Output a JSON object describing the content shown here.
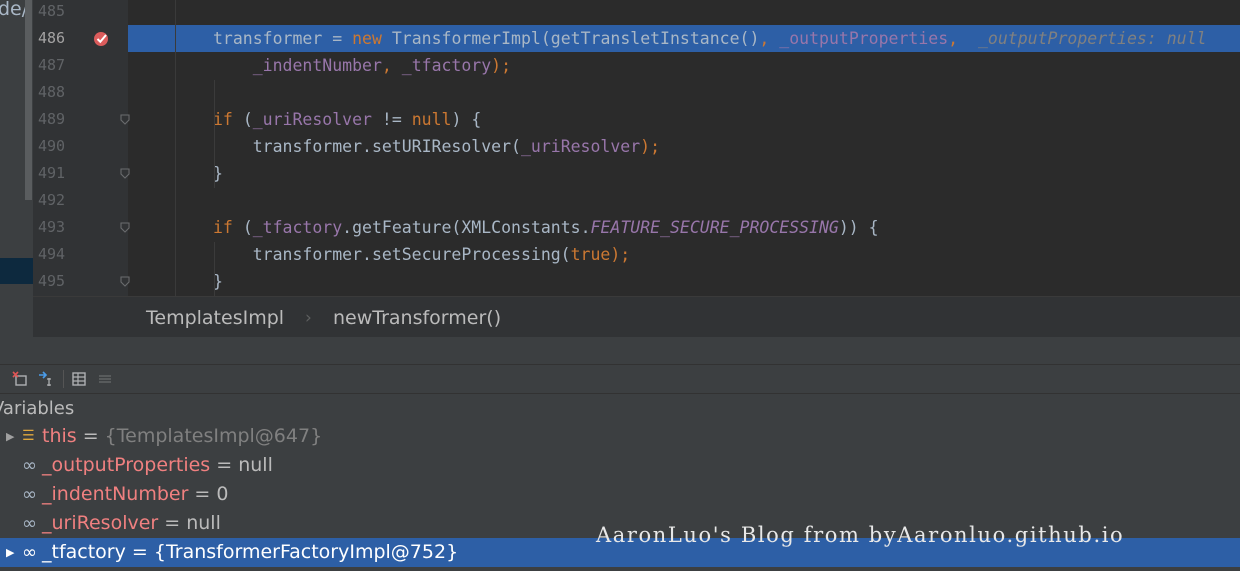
{
  "project_panel": {
    "text": "de/l"
  },
  "editor": {
    "lines": [
      {
        "num": "485",
        "parts": []
      },
      {
        "num": "486",
        "breakpoint": true,
        "highlighted": true,
        "parts": [
          {
            "t": "transformer ",
            "c": "plain"
          },
          {
            "t": "= ",
            "c": "plain"
          },
          {
            "t": "new ",
            "c": "kw"
          },
          {
            "t": "TransformerImpl(getTransletInstance()",
            "c": "plain"
          },
          {
            "t": ", ",
            "c": "kw"
          },
          {
            "t": "_outputProperties",
            "c": "fld"
          },
          {
            "t": ",  ",
            "c": "kw"
          },
          {
            "t": "_outputProperties: null",
            "c": "dbg"
          }
        ]
      },
      {
        "num": "487",
        "parts": [
          {
            "t": "    ",
            "c": "plain"
          },
          {
            "t": "_indentNumber",
            "c": "fld"
          },
          {
            "t": ", ",
            "c": "kw"
          },
          {
            "t": "_tfactory",
            "c": "fld"
          },
          {
            "t": ");",
            "c": "kw"
          }
        ]
      },
      {
        "num": "488",
        "parts": []
      },
      {
        "num": "489",
        "fold": true,
        "parts": [
          {
            "t": "if ",
            "c": "kw"
          },
          {
            "t": "(",
            "c": "plain"
          },
          {
            "t": "_uriResolver ",
            "c": "fld"
          },
          {
            "t": "!= ",
            "c": "plain"
          },
          {
            "t": "null",
            "c": "kw"
          },
          {
            "t": ") {",
            "c": "plain"
          }
        ]
      },
      {
        "num": "490",
        "parts": [
          {
            "t": "    transformer.setURIResolver(",
            "c": "plain"
          },
          {
            "t": "_uriResolver",
            "c": "fld"
          },
          {
            "t": ");",
            "c": "kw"
          }
        ]
      },
      {
        "num": "491",
        "fold": true,
        "parts": [
          {
            "t": "}",
            "c": "plain"
          }
        ]
      },
      {
        "num": "492",
        "parts": []
      },
      {
        "num": "493",
        "fold": true,
        "parts": [
          {
            "t": "if ",
            "c": "kw"
          },
          {
            "t": "(",
            "c": "plain"
          },
          {
            "t": "_tfactory",
            "c": "fld"
          },
          {
            "t": ".getFeature(XMLConstants.",
            "c": "plain"
          },
          {
            "t": "FEATURE_SECURE_PROCESSING",
            "c": "fld ital"
          },
          {
            "t": ")) {",
            "c": "plain"
          }
        ]
      },
      {
        "num": "494",
        "parts": [
          {
            "t": "    transformer.setSecureProcessing(",
            "c": "plain"
          },
          {
            "t": "true",
            "c": "kw"
          },
          {
            "t": ");",
            "c": "kw"
          }
        ]
      },
      {
        "num": "495",
        "fold": true,
        "parts": [
          {
            "t": "}",
            "c": "plain"
          }
        ]
      }
    ]
  },
  "breadcrumb": {
    "class": "TemplatesImpl",
    "method": "newTransformer()"
  },
  "debug_toolbar": {
    "icons": [
      "restore-layout-icon",
      "step-into-icon",
      "table-icon",
      "settings-list-icon"
    ]
  },
  "variables": {
    "title": "Variables",
    "rows": [
      {
        "expandable": true,
        "icon": "list",
        "name": "this",
        "eq": " = ",
        "value": "{TemplatesImpl@647}",
        "gray": true,
        "selected": false
      },
      {
        "expandable": false,
        "icon": "field",
        "name": "_outputProperties",
        "eq": " = ",
        "value": "null",
        "gray": false,
        "selected": false
      },
      {
        "expandable": false,
        "icon": "field",
        "name": "_indentNumber",
        "eq": " = ",
        "value": "0",
        "gray": false,
        "selected": false
      },
      {
        "expandable": false,
        "icon": "field",
        "name": "_uriResolver",
        "eq": " = ",
        "value": "null",
        "gray": false,
        "selected": false
      },
      {
        "expandable": true,
        "icon": "field",
        "name": "_tfactory",
        "eq": " = ",
        "value": "{TransformerFactoryImpl@752}",
        "gray": false,
        "selected": true
      }
    ]
  },
  "watermark": "AaronLuo's Blog from byAaronluo.github.io",
  "colors": {
    "selection": "#2d5fa6",
    "keyword": "#cc7832",
    "field": "#9876aa",
    "var_name": "#f08080"
  }
}
